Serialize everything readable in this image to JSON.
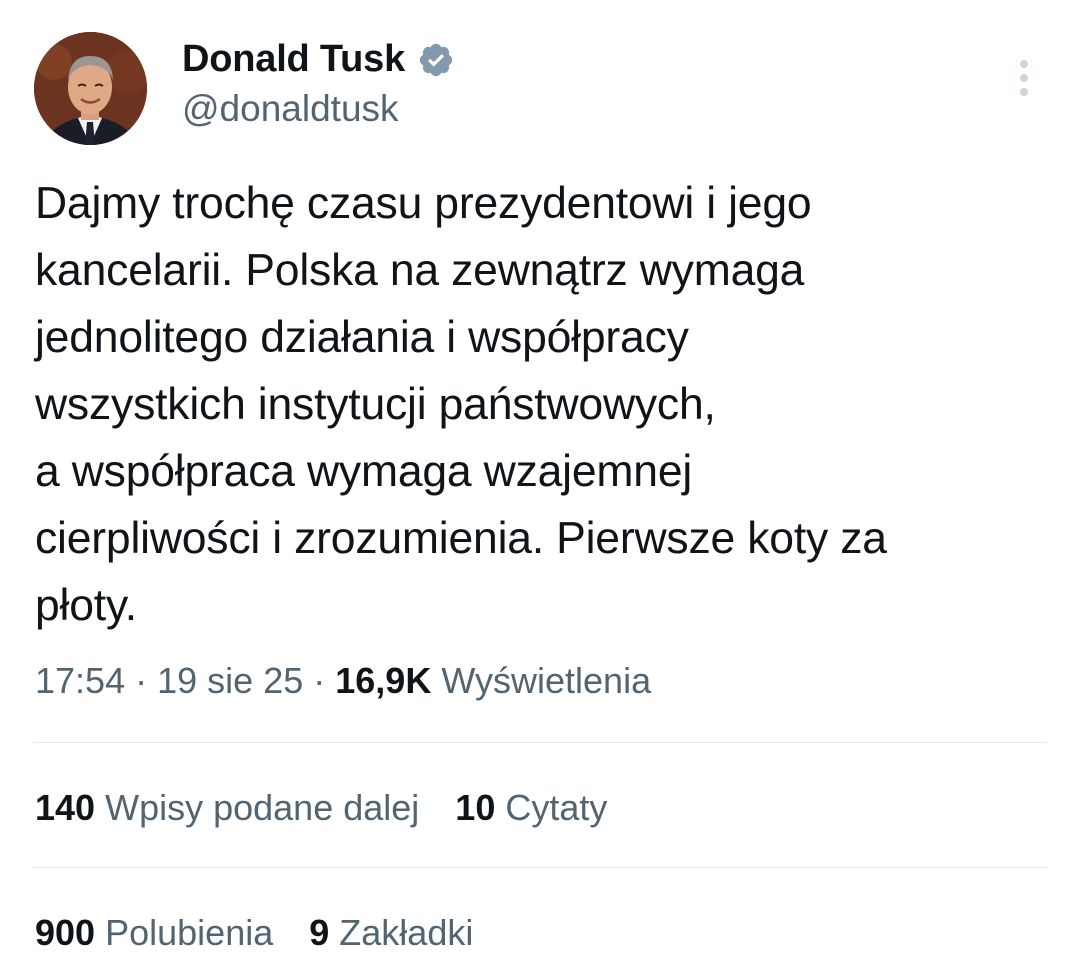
{
  "author": {
    "display_name": "Donald Tusk",
    "handle": "@donaldtusk",
    "verified": true,
    "verified_color": "#829aab"
  },
  "tweet": {
    "text": "Dajmy trochę czasu prezydentowi i jego\nkancelarii. Polska na zewnątrz wymaga\njednolitego działania i współpracy\nwszystkich instytucji państwowych,\na współpraca wymaga wzajemnej\ncierpliwości i zrozumienia. Pierwsze koty za\npłoty."
  },
  "meta": {
    "time": "17:54",
    "separator": "·",
    "date": "19 sie 25",
    "views_count": "16,9K",
    "views_label": "Wyświetlenia"
  },
  "stats": {
    "reposts_count": "140",
    "reposts_label": "Wpisy podane dalej",
    "quotes_count": "10",
    "quotes_label": "Cytaty",
    "likes_count": "900",
    "likes_label": "Polubienia",
    "bookmarks_count": "9",
    "bookmarks_label": "Zakładki"
  },
  "icons": {
    "more": "more-vertical-icon",
    "verified": "verified-badge-icon"
  }
}
